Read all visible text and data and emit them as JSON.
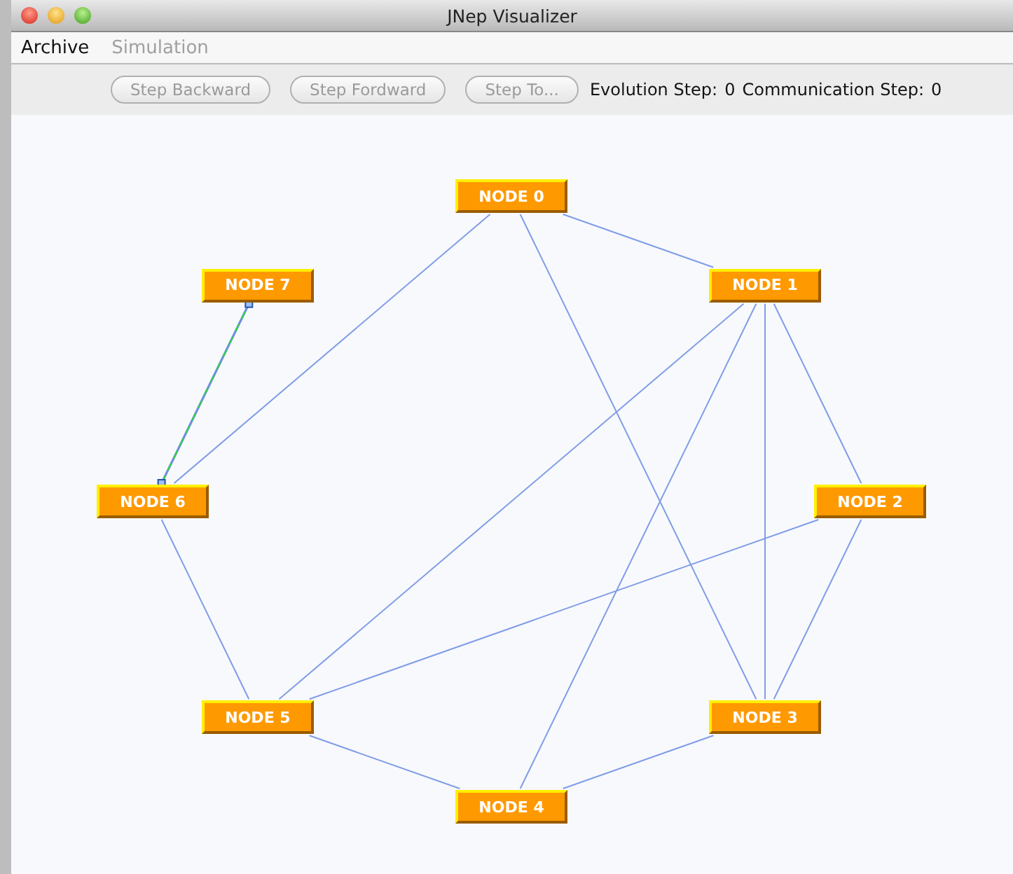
{
  "window": {
    "title": "JNep Visualizer"
  },
  "menu": [
    {
      "label": "Archive",
      "disabled": false
    },
    {
      "label": "Simulation",
      "disabled": true
    }
  ],
  "toolbar": {
    "buttons": [
      {
        "label": "Step Backward",
        "disabled": true
      },
      {
        "label": "Step Fordward",
        "disabled": true
      },
      {
        "label": "Step To...",
        "disabled": true
      }
    ],
    "evolution_label": "Evolution Step:",
    "evolution_value": "0",
    "communication_label": "Communication Step:",
    "communication_value": "0"
  },
  "graph": {
    "nodes": [
      {
        "label": "NODE 0",
        "links": [
          true,
          false,
          true,
          false,
          false,
          true,
          false
        ]
      },
      {
        "label": "NODE 1",
        "links": [
          true,
          true,
          true,
          true,
          false,
          false
        ]
      },
      {
        "label": "NODE 2",
        "links": [
          true,
          false,
          true,
          false,
          false
        ]
      },
      {
        "label": "NODE 3",
        "links": [
          true,
          false,
          false,
          false
        ]
      },
      {
        "label": "NODE 4",
        "links": [
          true,
          false,
          false
        ]
      },
      {
        "label": "NODE 5",
        "links": [
          true,
          false
        ]
      },
      {
        "label": "NODE 6",
        "links": [
          true
        ],
        "active_links": [
          true
        ]
      },
      {
        "label": "NODE 7"
      }
    ]
  }
}
